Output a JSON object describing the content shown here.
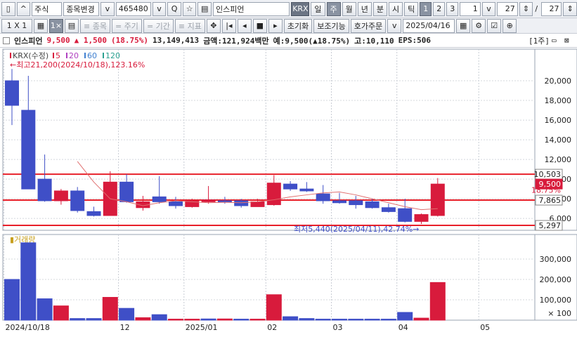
{
  "toolbar1": {
    "mode_label": "주식",
    "change_label": "종목변경",
    "code": "465480",
    "stock_name": "인스피언",
    "exchange": "KRX",
    "periods": [
      "일",
      "주",
      "월",
      "년",
      "분",
      "시",
      "틱"
    ],
    "selected_period": "주",
    "numbers": [
      "1",
      "2",
      "3"
    ],
    "count_value": "1",
    "page_value": "27",
    "page_total": "27"
  },
  "toolbar2": {
    "layout_label": "1 X 1",
    "buttons": [
      "≡ 종목",
      "= 주기",
      "= 기간",
      "≡ 지표"
    ],
    "reset_label": "초기화",
    "aux_label": "보조기능",
    "order_label": "호가주문",
    "date": "2025/04/16"
  },
  "infobar": {
    "name": "인스피언",
    "price": "9,500",
    "change": "▲ 1,500",
    "change_pct": "(18.75%)",
    "volume": "13,149,413",
    "amount": "금액:121,924백만",
    "expected": "예:9,500(▲18.75%)",
    "high": "고:10,110",
    "eps": "EPS:506",
    "unit": "[1주]"
  },
  "chart_data": {
    "type": "candlestick",
    "price_panel": {
      "legend": [
        "KRX(수정)",
        "5",
        "20",
        "60",
        "120"
      ],
      "yticks": [
        6000,
        8000,
        10000,
        12000,
        14000,
        16000,
        18000,
        20000
      ],
      "ylim": [
        4800,
        22500
      ],
      "max_annotation": "최고21,200(2024/10/18),123.16%",
      "min_annotation": "최저5,440(2025/04/11),42.74%",
      "hlines": [
        10503,
        7865,
        5297
      ],
      "price_tags": [
        "10,503",
        "9,500",
        "18.75%",
        "7,865",
        "5,297"
      ],
      "candles": [
        {
          "o": 20000,
          "h": 21200,
          "l": 15500,
          "c": 17500
        },
        {
          "o": 17000,
          "h": 20500,
          "l": 9000,
          "c": 9000
        },
        {
          "o": 10000,
          "h": 12500,
          "l": 7700,
          "c": 7800
        },
        {
          "o": 7800,
          "h": 9000,
          "l": 7400,
          "c": 8800
        },
        {
          "o": 8800,
          "h": 9200,
          "l": 6600,
          "c": 6800
        },
        {
          "o": 6700,
          "h": 7200,
          "l": 6200,
          "c": 6300
        },
        {
          "o": 6300,
          "h": 10800,
          "l": 6300,
          "c": 9700
        },
        {
          "o": 9700,
          "h": 10500,
          "l": 7600,
          "c": 7700
        },
        {
          "o": 7100,
          "h": 8300,
          "l": 6800,
          "c": 7700
        },
        {
          "o": 8200,
          "h": 10300,
          "l": 7500,
          "c": 7700
        },
        {
          "o": 7700,
          "h": 8200,
          "l": 7000,
          "c": 7300
        },
        {
          "o": 7200,
          "h": 8000,
          "l": 7100,
          "c": 7800
        },
        {
          "o": 7700,
          "h": 9300,
          "l": 7500,
          "c": 7900
        },
        {
          "o": 7800,
          "h": 8200,
          "l": 7500,
          "c": 7700
        },
        {
          "o": 7800,
          "h": 8000,
          "l": 7100,
          "c": 7300
        },
        {
          "o": 7200,
          "h": 8000,
          "l": 7200,
          "c": 7700
        },
        {
          "o": 7400,
          "h": 10400,
          "l": 7300,
          "c": 9600
        },
        {
          "o": 9500,
          "h": 9800,
          "l": 8800,
          "c": 9000
        },
        {
          "o": 9000,
          "h": 9700,
          "l": 8700,
          "c": 8800
        },
        {
          "o": 8500,
          "h": 9400,
          "l": 7500,
          "c": 7800
        },
        {
          "o": 7800,
          "h": 8600,
          "l": 7500,
          "c": 7600
        },
        {
          "o": 7800,
          "h": 8300,
          "l": 7000,
          "c": 7400
        },
        {
          "o": 7700,
          "h": 8000,
          "l": 7000,
          "c": 7100
        },
        {
          "o": 7100,
          "h": 7500,
          "l": 6600,
          "c": 6700
        },
        {
          "o": 7000,
          "h": 8000,
          "l": 5600,
          "c": 5700
        },
        {
          "o": 5700,
          "h": 6500,
          "l": 5440,
          "c": 6400
        },
        {
          "o": 6300,
          "h": 10110,
          "l": 6200,
          "c": 9500
        }
      ],
      "ma5": [
        null,
        null,
        null,
        null,
        11800,
        9700,
        8000,
        7700,
        7300,
        7600,
        7800,
        7700,
        7600,
        7650,
        7600,
        7700,
        7900,
        8200,
        8400,
        8600,
        8700,
        8400,
        8000,
        7600,
        7200,
        6900,
        7000
      ]
    },
    "volume_panel": {
      "legend": "거래량",
      "yticks": [
        100000,
        200000,
        300000
      ],
      "ytick_labels": [
        "100,000",
        "200,000",
        "300,000"
      ],
      "unit_label": "× 100",
      "ylim": [
        0,
        400000
      ],
      "values": [
        200000,
        380000,
        105000,
        70000,
        8000,
        8000,
        112000,
        58000,
        12000,
        27000,
        5000,
        5000,
        6000,
        6000,
        5000,
        5000,
        125000,
        17000,
        8000,
        5000,
        5000,
        5000,
        5000,
        5000,
        38000,
        10000,
        185000
      ],
      "up": [
        false,
        false,
        false,
        true,
        false,
        false,
        true,
        false,
        true,
        false,
        true,
        true,
        false,
        true,
        false,
        true,
        true,
        false,
        false,
        false,
        false,
        false,
        false,
        false,
        false,
        true,
        true
      ]
    },
    "xaxis_labels": [
      {
        "i": 0,
        "text": "2024/10/18"
      },
      {
        "i": 7,
        "text": "12"
      },
      {
        "i": 11,
        "text": "2025/01"
      },
      {
        "i": 16,
        "text": "02"
      },
      {
        "i": 20,
        "text": "03"
      },
      {
        "i": 24,
        "text": "04"
      },
      {
        "i": 29,
        "text": "05"
      }
    ]
  }
}
